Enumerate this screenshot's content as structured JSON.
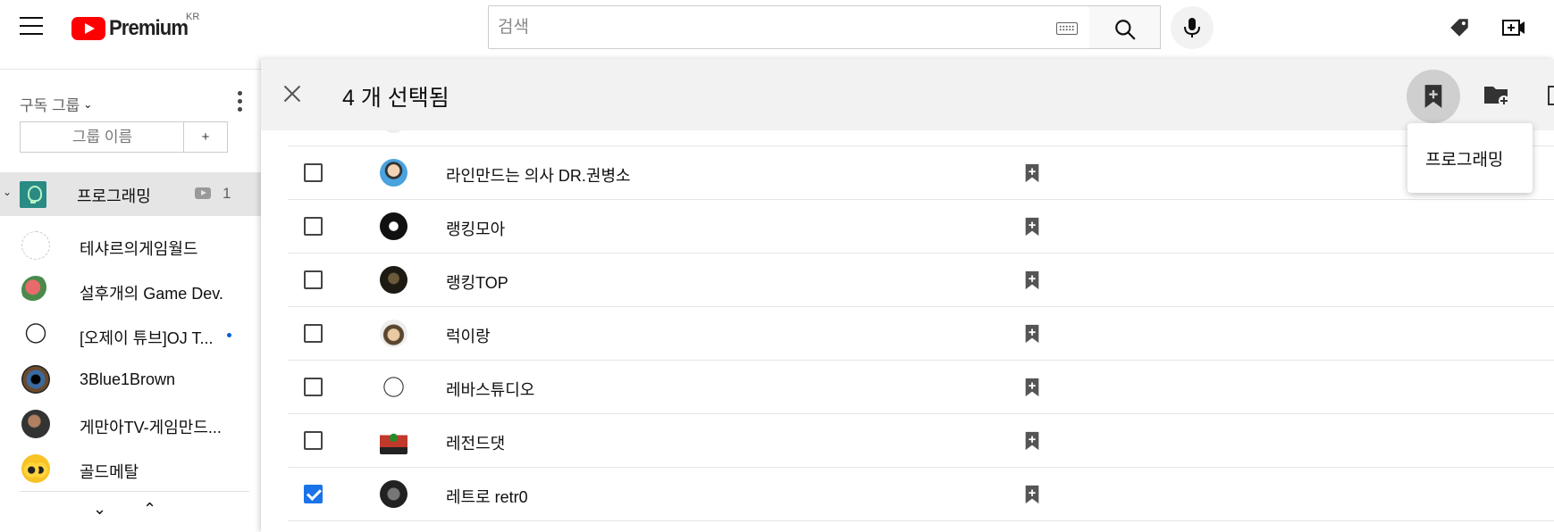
{
  "header": {
    "logo_text": "Premium",
    "region": "KR",
    "search_placeholder": "검색"
  },
  "sidebar": {
    "title": "구독 그룹",
    "group_input_placeholder": "그룹 이름",
    "add_label": "+",
    "active_group": {
      "name": "프로그래밍",
      "count": "1"
    },
    "channels": [
      {
        "name": "테샤르의게임월드"
      },
      {
        "name": "설후개의 Game Dev."
      },
      {
        "name": "[오제이 튜브]OJ T...",
        "new": true
      },
      {
        "name": "3Blue1Brown"
      },
      {
        "name": "게만아TV-게임만드..."
      },
      {
        "name": "골드메탈"
      }
    ]
  },
  "panel": {
    "selected_text": "4 개 선택됨",
    "dropdown_item": "프로그래밍",
    "rows": [
      {
        "name": "",
        "checked": false
      },
      {
        "name": "라인만드는 의사 DR.권병소",
        "checked": false
      },
      {
        "name": "랭킹모아",
        "checked": false
      },
      {
        "name": "랭킹TOP",
        "checked": false
      },
      {
        "name": "럭이랑",
        "checked": false
      },
      {
        "name": "레바스튜디오",
        "checked": false
      },
      {
        "name": "레전드댓",
        "checked": false
      },
      {
        "name": "레트로 retr0",
        "checked": true
      }
    ]
  },
  "colors": {
    "accent": "#1a73e8",
    "brand_red": "#ff0000",
    "header_bg": "#f2f2f2"
  }
}
